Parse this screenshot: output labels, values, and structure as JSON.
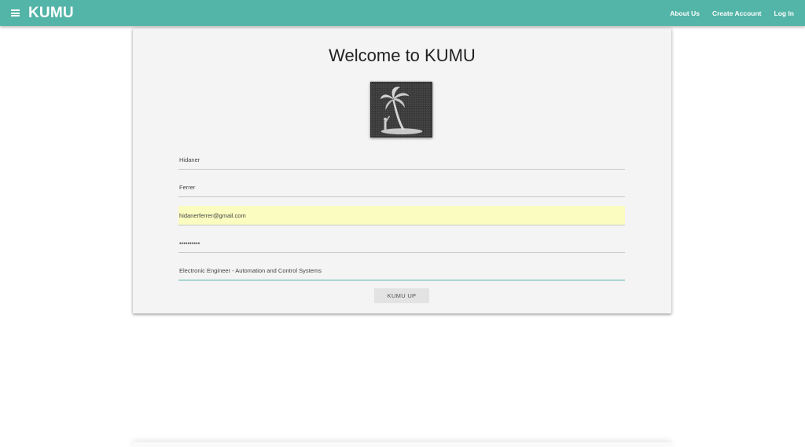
{
  "navbar": {
    "brand": "KUMU",
    "menu_icon": "hamburger-menu-icon",
    "links": [
      "About Us",
      "Create Account",
      "Log In"
    ],
    "color": "#53b4a8"
  },
  "card": {
    "title": "Welcome to KUMU",
    "logo_icon": "palm-tree-island-icon"
  },
  "form": {
    "first_name": "Hidaner",
    "last_name": "Ferrer",
    "email": "hidanerferrer@gmail.com",
    "password": "••••••••••",
    "profession": "Electronic Engineer - Automation and Control Systems",
    "submit_label": "KUMU UP",
    "autofill_color": "#fafcc0"
  }
}
